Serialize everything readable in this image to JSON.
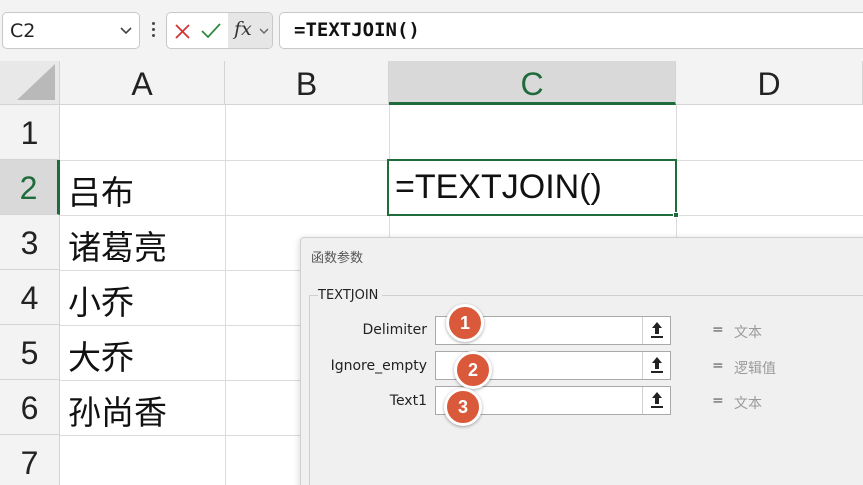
{
  "formula_bar": {
    "name_box": "C2",
    "cancel_icon": "x-icon",
    "confirm_icon": "check-icon",
    "fx_label": "fx",
    "formula": "=TEXTJOIN()"
  },
  "grid": {
    "columns": [
      "A",
      "B",
      "C",
      "D"
    ],
    "active_column": "C",
    "rows": [
      "1",
      "2",
      "3",
      "4",
      "5",
      "6",
      "7"
    ],
    "active_row": "2",
    "column_a_values": [
      "",
      "吕布",
      "诸葛亮",
      "小乔",
      "大乔",
      "孙尚香",
      ""
    ],
    "active_cell": {
      "ref": "C2",
      "value": "=TEXTJOIN()"
    }
  },
  "dialog": {
    "title": "函数参数",
    "function_name": "TEXTJOIN",
    "arguments": [
      {
        "label": "Delimiter",
        "value": "",
        "result": "文本",
        "badge": "1"
      },
      {
        "label": "Ignore_empty",
        "value": "",
        "result": "逻辑值",
        "badge": "2"
      },
      {
        "label": "Text1",
        "value": "",
        "result": "文本",
        "badge": "3"
      }
    ],
    "equals_sign": "="
  },
  "colors": {
    "accent_green": "#1e6b3b",
    "badge_orange": "#d9593a",
    "cancel_red": "#d03434",
    "confirm_green": "#2f8a3f"
  }
}
